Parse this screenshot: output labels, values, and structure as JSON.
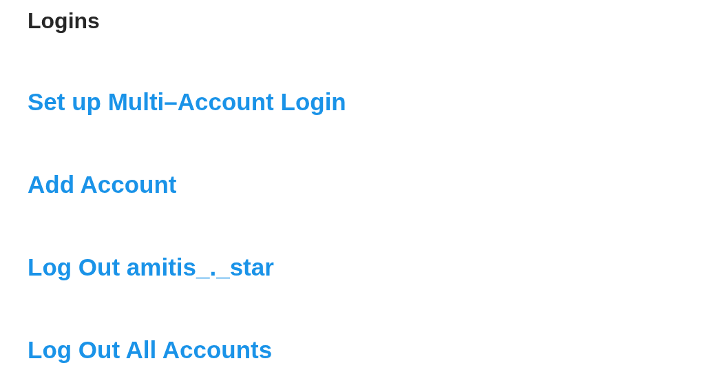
{
  "section_title": "Logins",
  "items": [
    {
      "label": "Set up Multi–Account Login"
    },
    {
      "label": "Add Account"
    },
    {
      "label": "Log Out amitis_._star"
    },
    {
      "label": "Log Out All Accounts"
    }
  ]
}
